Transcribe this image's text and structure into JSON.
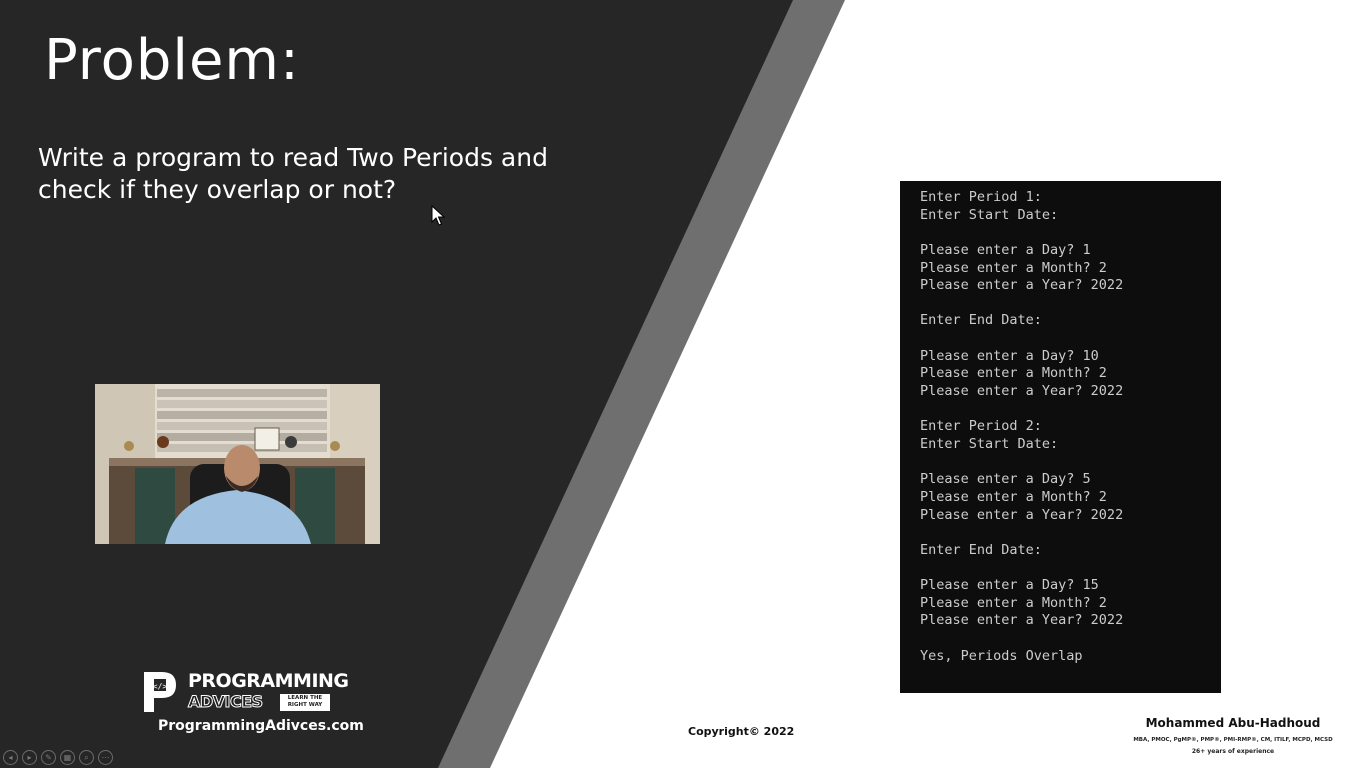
{
  "slide": {
    "title": "Problem:",
    "problem_lines": [
      "Write a program to read Two Periods and",
      "check if they overlap or not?"
    ]
  },
  "colors": {
    "dark_panel": "#262626",
    "gray_stripe": "#6f6f6f",
    "console_bg": "#0d0d0d",
    "console_text": "#cccccc"
  },
  "console": {
    "lines": [
      "Enter Period 1:",
      "Enter Start Date:",
      "",
      "Please enter a Day? 1",
      "Please enter a Month? 2",
      "Please enter a Year? 2022",
      "",
      "Enter End Date:",
      "",
      "Please enter a Day? 10",
      "Please enter a Month? 2",
      "Please enter a Year? 2022",
      "",
      "Enter Period 2:",
      "Enter Start Date:",
      "",
      "Please enter a Day? 5",
      "Please enter a Month? 2",
      "Please enter a Year? 2022",
      "",
      "Enter End Date:",
      "",
      "Please enter a Day? 15",
      "Please enter a Month? 2",
      "Please enter a Year? 2022",
      "",
      "Yes, Periods Overlap"
    ]
  },
  "logo": {
    "word1": "PROGRAMMING",
    "word2": "ADVICES",
    "tagline": "LEARN THE RIGHT WAY",
    "website": "ProgrammingAdivces.com"
  },
  "footer": {
    "copyright": "Copyright© 2022",
    "author_name": "Mohammed Abu-Hadhoud",
    "author_credentials": "MBA, PMOC, PgMP®, PMP®, PMI-RMP®, CM, ITILF, MCPD, MCSD",
    "author_experience": "26+ years of experience"
  },
  "player_controls": [
    {
      "name": "previous-icon",
      "glyph": "◂"
    },
    {
      "name": "next-icon",
      "glyph": "▸"
    },
    {
      "name": "pen-icon",
      "glyph": "✎"
    },
    {
      "name": "slides-icon",
      "glyph": "▦"
    },
    {
      "name": "zoom-icon",
      "glyph": "⌕"
    },
    {
      "name": "more-icon",
      "glyph": "⋯"
    }
  ]
}
